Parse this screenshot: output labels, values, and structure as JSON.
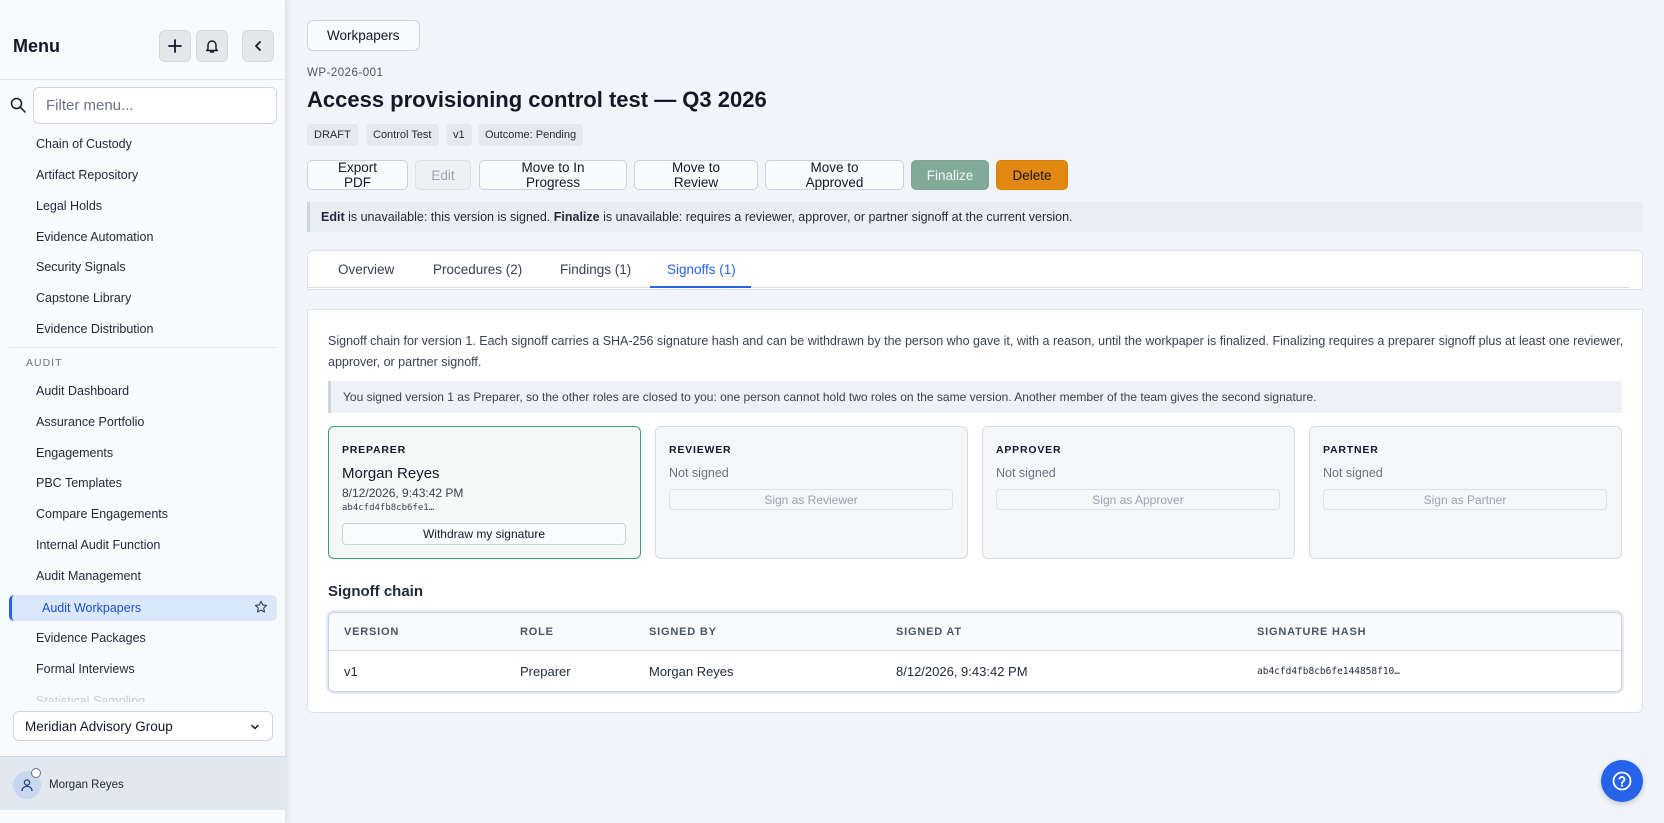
{
  "sidebar": {
    "title": "Menu",
    "search_placeholder": "Filter menu...",
    "items_top": [
      "Chain of Custody",
      "Artifact Repository",
      "Legal Holds",
      "Evidence Automation",
      "Security Signals",
      "Capstone Library",
      "Evidence Distribution"
    ],
    "section_audit": "AUDIT",
    "items_audit": [
      "Audit Dashboard",
      "Assurance Portfolio",
      "Engagements",
      "PBC Templates",
      "Compare Engagements",
      "Internal Audit Function",
      "Audit Management"
    ],
    "active_item": "Audit Workpapers",
    "items_after": [
      "Evidence Packages",
      "Formal Interviews"
    ],
    "faded_item": "Statistical Sampling",
    "org": "Meridian Advisory Group",
    "user_name": "Morgan Reyes"
  },
  "breadcrumb": "Workpapers",
  "workpaper": {
    "id": "WP-2026-001",
    "title": "Access provisioning control test — Q3 2026",
    "badges": [
      "DRAFT",
      "Control Test",
      "v1",
      "Outcome: Pending"
    ]
  },
  "actions": {
    "export": "Export PDF",
    "edit": "Edit",
    "in_progress": "Move to In Progress",
    "review": "Move to Review",
    "approved": "Move to Approved",
    "finalize": "Finalize",
    "delete": "Delete"
  },
  "notice": {
    "edit_bold": "Edit",
    "edit_text": " is unavailable: this version is signed. ",
    "finalize_bold": "Finalize",
    "finalize_text": " is unavailable: requires a reviewer, approver, or partner signoff at the current version."
  },
  "tabs": [
    "Overview",
    "Procedures (2)",
    "Findings (1)",
    "Signoffs (1)"
  ],
  "signoffs": {
    "description": "Signoff chain for version 1. Each signoff carries a SHA-256 signature hash and can be withdrawn by the person who gave it, with a reason, until the workpaper is finalized. Finalizing requires a preparer signoff plus at least one reviewer, approver, or partner signoff.",
    "info": "You signed version 1 as Preparer, so the other roles are closed to you: one person cannot hold two roles on the same version. Another member of the team gives the second signature.",
    "preparer": {
      "title": "PREPARER",
      "name": "Morgan Reyes",
      "signed_at": "8/12/2026, 9:43:42 PM",
      "hash": "ab4cfd4fb8cb6fe1…",
      "withdraw": "Withdraw my signature"
    },
    "reviewer": {
      "title": "REVIEWER",
      "status": "Not signed",
      "button": "Sign as Reviewer"
    },
    "approver": {
      "title": "APPROVER",
      "status": "Not signed",
      "button": "Sign as Approver"
    },
    "partner": {
      "title": "PARTNER",
      "status": "Not signed",
      "button": "Sign as Partner"
    },
    "chain_title": "Signoff chain",
    "columns": [
      "VERSION",
      "ROLE",
      "SIGNED BY",
      "SIGNED AT",
      "SIGNATURE HASH"
    ],
    "rows": [
      {
        "version": "v1",
        "role": "Preparer",
        "signed_by": "Morgan Reyes",
        "signed_at": "8/12/2026, 9:43:42 PM",
        "hash": "ab4cfd4fb8cb6fe144858f10…"
      }
    ]
  },
  "colors": {
    "accent": "#2563eb",
    "finalize": "#82aa9a",
    "delete": "#e2870f",
    "signed_border": "#3aa275"
  }
}
